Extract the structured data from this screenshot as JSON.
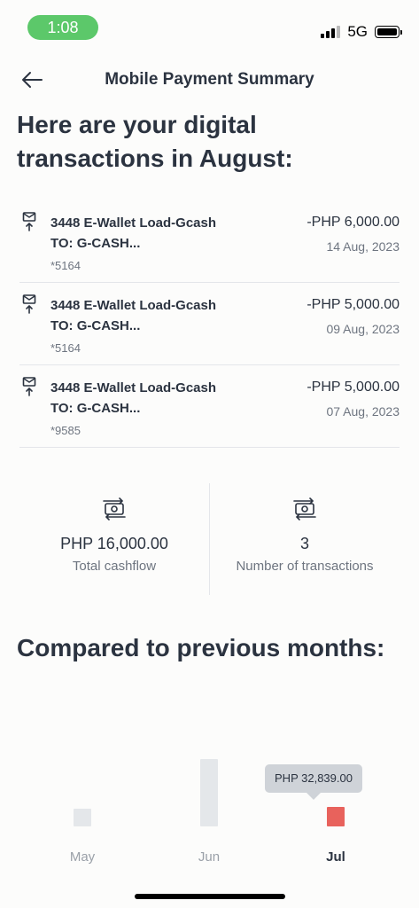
{
  "status_bar": {
    "time": "1:08",
    "network": "5G"
  },
  "header": {
    "title": "Mobile Payment Summary"
  },
  "headline": "Here are your digital transactions in August:",
  "transactions": [
    {
      "description": "3448 E-Wallet Load-Gcash TO: G-CASH...",
      "card": "*5164",
      "amount": "-PHP 6,000.00",
      "date": "14 Aug, 2023"
    },
    {
      "description": "3448 E-Wallet Load-Gcash TO: G-CASH...",
      "card": "*5164",
      "amount": "-PHP 5,000.00",
      "date": "09 Aug, 2023"
    },
    {
      "description": "3448 E-Wallet Load-Gcash TO: G-CASH...",
      "card": "*9585",
      "amount": "-PHP 5,000.00",
      "date": "07 Aug, 2023"
    }
  ],
  "summary": {
    "total_cashflow_value": "PHP 16,000.00",
    "total_cashflow_label": "Total cashflow",
    "transactions_count_value": "3",
    "transactions_count_label": "Number of transactions"
  },
  "compare_title": "Compared to previous months:",
  "chart_data": {
    "type": "bar",
    "categories": [
      "May",
      "Jun",
      "Jul"
    ],
    "values": [
      3000,
      11000,
      32839
    ],
    "selected": "Jul",
    "tooltip": "PHP 32,839.00",
    "colors": {
      "default": "#e4e7ea",
      "selected": "#e8625c"
    }
  },
  "icons": {
    "back": "arrow-left-icon",
    "transaction": "mail-upload-icon",
    "cash": "cash-exchange-icon"
  }
}
